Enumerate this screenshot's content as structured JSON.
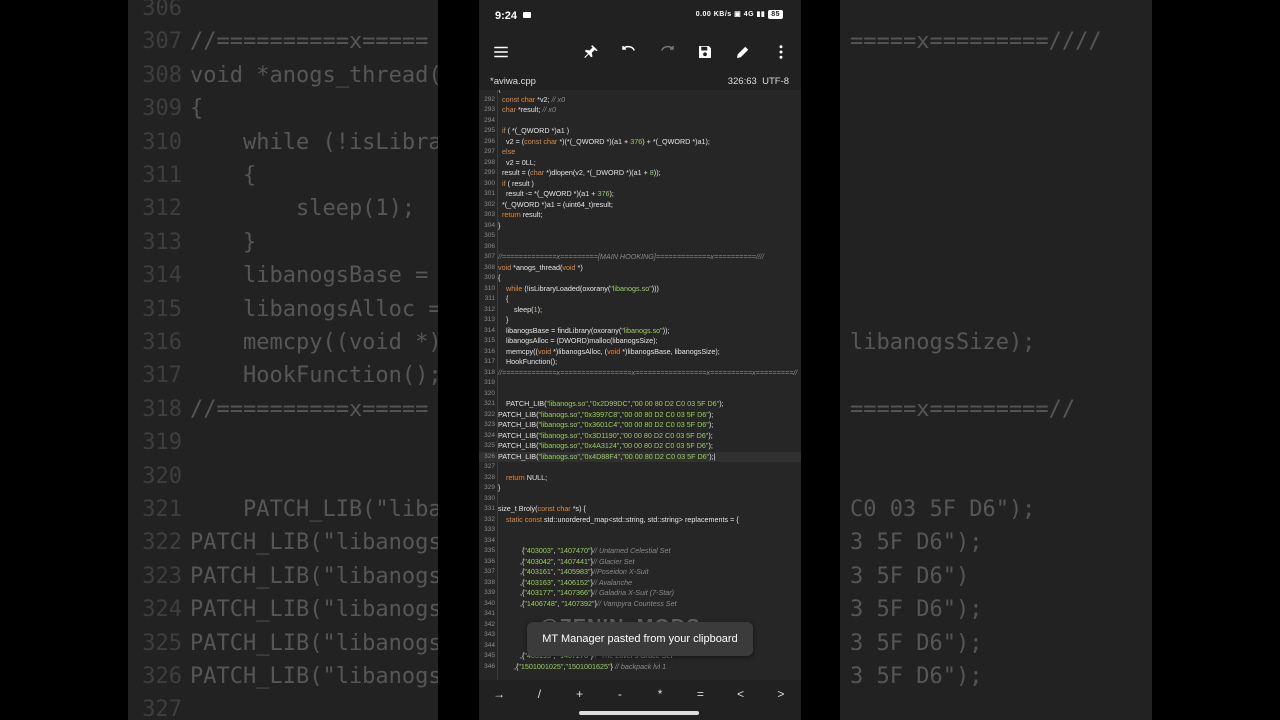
{
  "status": {
    "time": "9:24",
    "right": "0.00 KB/s ▣ 4G ▮▮",
    "battery": "85"
  },
  "file": {
    "name": "*aviwa.cpp",
    "position": "326:63",
    "encoding": "UTF-8"
  },
  "toast": {
    "text": "MT Manager pasted from your clipboard"
  },
  "watermark": "@ZENIN_MODS",
  "symbols": [
    "→",
    "/",
    "+",
    "-",
    "*",
    "=",
    "<",
    ">"
  ],
  "bg_lines": [
    {
      "n": "306",
      "t": ""
    },
    {
      "n": "307",
      "t": "//==========x====="
    },
    {
      "n": "308",
      "t": "void *anogs_thread(vo"
    },
    {
      "n": "309",
      "t": "{"
    },
    {
      "n": "310",
      "t": "    while (!isLibraryLo"
    },
    {
      "n": "311",
      "t": "    {"
    },
    {
      "n": "312",
      "t": "        sleep(1);"
    },
    {
      "n": "313",
      "t": "    }"
    },
    {
      "n": "314",
      "t": "    libanogsBase = fi"
    },
    {
      "n": "315",
      "t": "    libanogsAlloc = (l"
    },
    {
      "n": "316",
      "t": "    memcpy((void *)li"
    },
    {
      "n": "317",
      "t": "    HookFunction();"
    },
    {
      "n": "318",
      "t": "//==========x====="
    },
    {
      "n": "319",
      "t": ""
    },
    {
      "n": "320",
      "t": ""
    },
    {
      "n": "321",
      "t": "    PATCH_LIB(\"liban"
    },
    {
      "n": "322",
      "t": "PATCH_LIB(\"libanogs."
    },
    {
      "n": "323",
      "t": "PATCH_LIB(\"libanogs."
    },
    {
      "n": "324",
      "t": "PATCH_LIB(\"libanogs."
    },
    {
      "n": "325",
      "t": "PATCH_LIB(\"libanogs."
    },
    {
      "n": "326",
      "t": "PATCH_LIB(\"libanogs."
    },
    {
      "n": "327",
      "t": ""
    }
  ],
  "bg_right": [
    {
      "t": "=====x=========////",
      "row": 1
    },
    {
      "t": "libanogsSize);",
      "row": 10
    },
    {
      "t": "=====x=========//",
      "row": 12
    },
    {
      "t": "C0 03 5F D6\");",
      "row": 15
    },
    {
      "t": "3 5F D6\");",
      "row": 16
    },
    {
      "t": "3 5F D6\")",
      "row": 17
    },
    {
      "t": "3 5F D6\");",
      "row": 18
    },
    {
      "t": "3 5F D6\");",
      "row": 19
    },
    {
      "t": "3 5F D6\");",
      "row": 20
    }
  ],
  "code": [
    {
      "n": "291",
      "h": "{"
    },
    {
      "n": "292",
      "h": "  <span class='kw'>const char</span> *v2; <span class='cmt'>// x0</span>"
    },
    {
      "n": "293",
      "h": "  <span class='kw'>char</span> *result; <span class='cmt'>// x0</span>"
    },
    {
      "n": "294",
      "h": ""
    },
    {
      "n": "295",
      "h": "  <span class='kw'>if</span> ( *(_QWORD *)a1 )"
    },
    {
      "n": "296",
      "h": "    v2 = (<span class='kw'>const char</span> *)(*(_QWORD *)(a1 + <span class='str'>376</span>) + *(_QWORD *)a1);"
    },
    {
      "n": "297",
      "h": "  <span class='kw'>else</span>"
    },
    {
      "n": "298",
      "h": "    v2 = 0LL;"
    },
    {
      "n": "299",
      "h": "  result = (<span class='kw'>char</span> *)dlopen(v2, *(_DWORD *)(a1 + <span class='str'>8</span>));"
    },
    {
      "n": "300",
      "h": "  <span class='kw'>if</span> ( result )"
    },
    {
      "n": "301",
      "h": "    result -= *(_QWORD *)(a1 + <span class='str'>376</span>);"
    },
    {
      "n": "302",
      "h": "  *(_QWORD *)a1 = (uint64_t)result;"
    },
    {
      "n": "303",
      "h": "  <span class='kw'>return</span> result;"
    },
    {
      "n": "304",
      "h": "}"
    },
    {
      "n": "305",
      "h": ""
    },
    {
      "n": "306",
      "h": ""
    },
    {
      "n": "307",
      "h": "<span class='cmt'>//=============x=========[MAIN HOOKING]=============x==========////</span>"
    },
    {
      "n": "308",
      "h": "<span class='kw'>void</span> *anogs_thread(<span class='kw'>void</span> *)"
    },
    {
      "n": "309",
      "h": "{"
    },
    {
      "n": "310",
      "h": "    <span class='kw'>while</span> (!isLibraryLoaded(oxorany(<span class='str'>\"libanogs.so\"</span>)))"
    },
    {
      "n": "311",
      "h": "    {"
    },
    {
      "n": "312",
      "h": "        sleep(<span class='str'>1</span>);"
    },
    {
      "n": "313",
      "h": "    }"
    },
    {
      "n": "314",
      "h": "    libanogsBase = findLibrary(oxorany(<span class='str'>\"libanogs.so\"</span>));"
    },
    {
      "n": "315",
      "h": "    libanogsAlloc = (DWORD)malloc(libanogsSize);"
    },
    {
      "n": "316",
      "h": "    memcpy((<span class='kw'>void</span> *)libanogsAlloc, (<span class='kw'>void</span> *)libanogsBase, libanogsSize);"
    },
    {
      "n": "317",
      "h": "    HookFunction();"
    },
    {
      "n": "318",
      "h": "<span class='cmt'>//=============x=================x=================x==========x=========//</span>"
    },
    {
      "n": "319",
      "h": ""
    },
    {
      "n": "320",
      "h": ""
    },
    {
      "n": "321",
      "h": "    PATCH_LIB(<span class='str'>\"libanogs.so\"</span>,<span class='str'>\"0x2D99DC\"</span>,<span class='str'>\"00 00 80 D2 C0 03 5F D6\"</span>);"
    },
    {
      "n": "322",
      "h": "PATCH_LIB(<span class='str'>\"libanogs.so\"</span>,<span class='str'>\"0x3997C8\"</span>,<span class='str'>\"00 00 80 D2 C0 03 5F D6\"</span>);"
    },
    {
      "n": "323",
      "h": "PATCH_LIB(<span class='str'>\"libanogs.so\"</span>,<span class='str'>\"0x3601C4\"</span>,<span class='str'>\"00 00 80 D2 C0 03 5F D6\"</span>);"
    },
    {
      "n": "324",
      "h": "PATCH_LIB(<span class='str'>\"libanogs.so\"</span>,<span class='str'>\"0x3D1190\"</span>,<span class='str'>\"00 00 80 D2 C0 03 5F D6\"</span>);"
    },
    {
      "n": "325",
      "h": "PATCH_LIB(<span class='str'>\"libanogs.so\"</span>,<span class='str'>\"0x4A3124\"</span>,<span class='str'>\"00 00 80 D2 C0 03 5F D6\"</span>);"
    },
    {
      "n": "326",
      "h": "PATCH_LIB(<span class='str'>\"libanogs.so\"</span>,<span class='str'>\"0x4D88F4\"</span>,<span class='str'>\"00 00 80 D2 C0 03 5F D6\"</span>);|",
      "cur": true
    },
    {
      "n": "327",
      "h": ""
    },
    {
      "n": "328",
      "h": "    <span class='kw'>return</span> NULL;"
    },
    {
      "n": "329",
      "h": "}"
    },
    {
      "n": "330",
      "h": ""
    },
    {
      "n": "331",
      "h": "size_t Broly(<span class='kw'>const char</span> *s) {"
    },
    {
      "n": "332",
      "h": "    <span class='kw'>static const</span> std::unordered_map&lt;std::string, std::string&gt; replacements = {"
    },
    {
      "n": "333",
      "h": ""
    },
    {
      "n": "334",
      "h": ""
    },
    {
      "n": "335",
      "h": "            {<span class='str'>\"403003\"</span>, <span class='str'>\"1407470\"</span>}<span class='cmt'>// Untamed Celestial Set</span>"
    },
    {
      "n": "336",
      "h": "           ,{<span class='str'>\"403042\"</span>, <span class='str'>\"1407441\"</span>}<span class='cmt'>// Glacier Set</span>"
    },
    {
      "n": "337",
      "h": "           ,{<span class='str'>\"403161\"</span>, <span class='str'>\"1405983\"</span>}<span class='cmt'>//Poseidon X-Suit</span>"
    },
    {
      "n": "338",
      "h": "           ,{<span class='str'>\"403163\"</span>, <span class='str'>\"1406152\"</span>}<span class='cmt'>// Avalanche</span>"
    },
    {
      "n": "339",
      "h": "           ,{<span class='str'>\"403177\"</span>, <span class='str'>\"1407366\"</span>}<span class='cmt'>// Galadria X-Suit (7-Star)</span>"
    },
    {
      "n": "340",
      "h": "           ,{<span class='str'>\"1406748\"</span>, <span class='str'>\"1407392\"</span>}<span class='cmt'>// Vampyra Countess Set</span>"
    },
    {
      "n": "341",
      "h": ""
    },
    {
      "n": "342",
      "h": ""
    },
    {
      "n": "343",
      "h": ""
    },
    {
      "n": "344",
      "h": ""
    },
    {
      "n": "345",
      "h": "           ,{<span class='str'>\"403195\"</span>, <span class='str'>\"1407276\"</span>}<span class='cmt'>//  The Lover's Grace Set</span>"
    },
    {
      "n": "346",
      "h": "        ,{<span class='str'>\"1501001025\"</span>,<span class='str'>\"1501001625\"</span>} <span class='cmt'>// backpack lvl 1</span>"
    }
  ]
}
